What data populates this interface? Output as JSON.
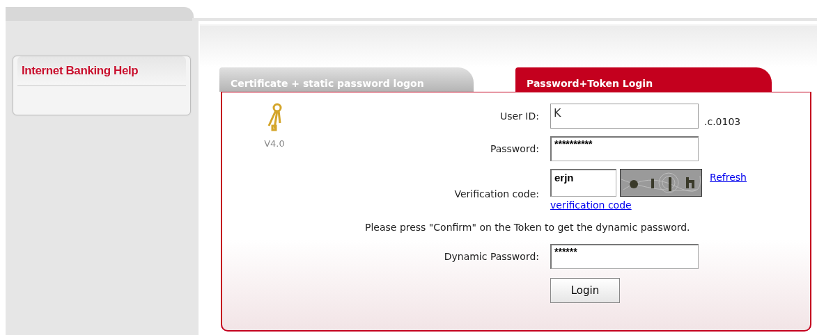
{
  "sidebar": {
    "title": "Internet Banking Help"
  },
  "tabs": [
    {
      "label": "Certificate + static password logon",
      "selected": false
    },
    {
      "label": "Password+Token Login",
      "selected": true
    }
  ],
  "version": "V4.0",
  "form": [
    {
      "kind": "text",
      "label": "User ID:",
      "value": "K",
      "suffix": ".c.0103"
    },
    {
      "kind": "password",
      "label": "Password:",
      "value": "**********"
    },
    {
      "kind": "captcha",
      "label": "Verification code:",
      "value": "erjn",
      "link_lines": [
        "Refresh",
        "verification code"
      ]
    },
    {
      "kind": "note",
      "text": "Please press \"Confirm\" on the Token to get the dynamic password."
    },
    {
      "kind": "password",
      "label": "Dynamic Password:",
      "value": "******"
    }
  ],
  "login_button": "Login"
}
